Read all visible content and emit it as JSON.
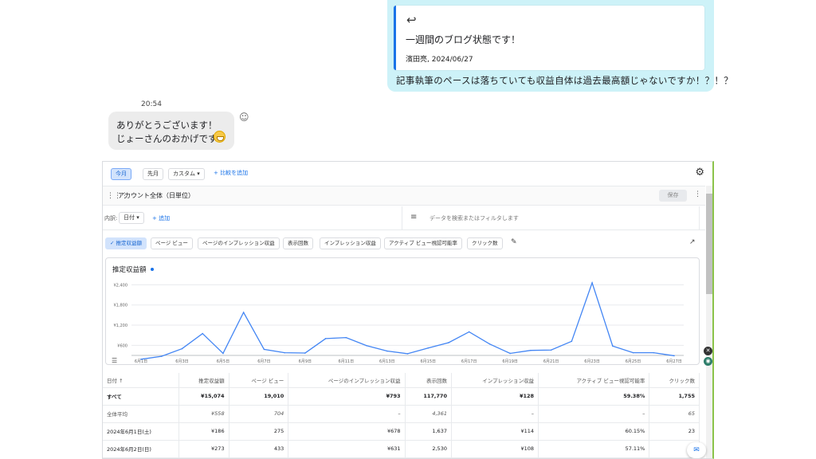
{
  "chat": {
    "reply_icon": "reply-arrow-icon",
    "quote_text": "一週間のブログ状態です！",
    "quote_author": "濱田亮, 2024/06/27",
    "reply_text": "記事執筆のペースは落ちていても収益自体は過去最高額じゃないですか！？！？",
    "time": "20:54",
    "bubble_line1": "ありがとうございます！",
    "bubble_line2": "じょーさんのおかげです"
  },
  "panel": {
    "date_chips": [
      "今月",
      "先月",
      "カスタム ▾",
      "+ 比較を追加"
    ],
    "account_label": "アカウント全体（日単位）",
    "save_label": "保存",
    "breakdown_label": "内訳:",
    "breakdown_value": "日付 ▾",
    "add_label": "+ 追加",
    "filter_placeholder": "データを検索またはフィルタします",
    "metric_chips": [
      "✓ 推定収益額",
      "ページ ビュー",
      "ページのインプレッション収益",
      "表示回数",
      "インプレッション収益",
      "アクティブ ビュー視認可能率",
      "クリック数"
    ]
  },
  "chart_data": {
    "type": "line",
    "title": "推定収益額",
    "y_ticks": [
      "¥2,400",
      "¥1,800",
      "¥1,200",
      "¥600"
    ],
    "ylim": [
      300,
      2600
    ],
    "x_ticks": [
      "6月1日",
      "6月3日",
      "6月5日",
      "6月7日",
      "6月9日",
      "6月11日",
      "6月13日",
      "6月15日",
      "6月17日",
      "6月19日",
      "6月21日",
      "6月23日",
      "6月25日",
      "6月27日"
    ],
    "x": [
      "6/1",
      "6/2",
      "6/3",
      "6/4",
      "6/5",
      "6/6",
      "6/7",
      "6/8",
      "6/9",
      "6/10",
      "6/11",
      "6/12",
      "6/13",
      "6/14",
      "6/15",
      "6/16",
      "6/17",
      "6/18",
      "6/19",
      "6/20",
      "6/21",
      "6/22",
      "6/23",
      "6/24",
      "6/25",
      "6/26",
      "6/27"
    ],
    "values": [
      186,
      273,
      500,
      950,
      360,
      1580,
      480,
      380,
      370,
      800,
      830,
      590,
      430,
      350,
      520,
      680,
      1000,
      640,
      360,
      450,
      460,
      720,
      2460,
      580,
      380,
      380,
      290
    ],
    "color": "#4285f4",
    "grid": true
  },
  "table": {
    "headers": [
      "日付 ↑",
      "推定収益額",
      "ページ ビュー",
      "ページのインプレッション収益",
      "表示回数",
      "インプレッション収益",
      "アクティブ ビュー視認可能率",
      "クリック数"
    ],
    "rows": [
      [
        "すべて",
        "¥15,074",
        "19,010",
        "¥793",
        "117,770",
        "¥128",
        "59.38%",
        "1,755"
      ],
      [
        "全体平均",
        "¥558",
        "704",
        "–",
        "4,361",
        "–",
        "–",
        "65"
      ],
      [
        "2024年6月1日(土)",
        "¥186",
        "275",
        "¥678",
        "1,637",
        "¥114",
        "60.15%",
        "23"
      ],
      [
        "2024年6月2日(日)",
        "¥273",
        "433",
        "¥631",
        "2,530",
        "¥108",
        "57.11%",
        "49"
      ]
    ]
  }
}
